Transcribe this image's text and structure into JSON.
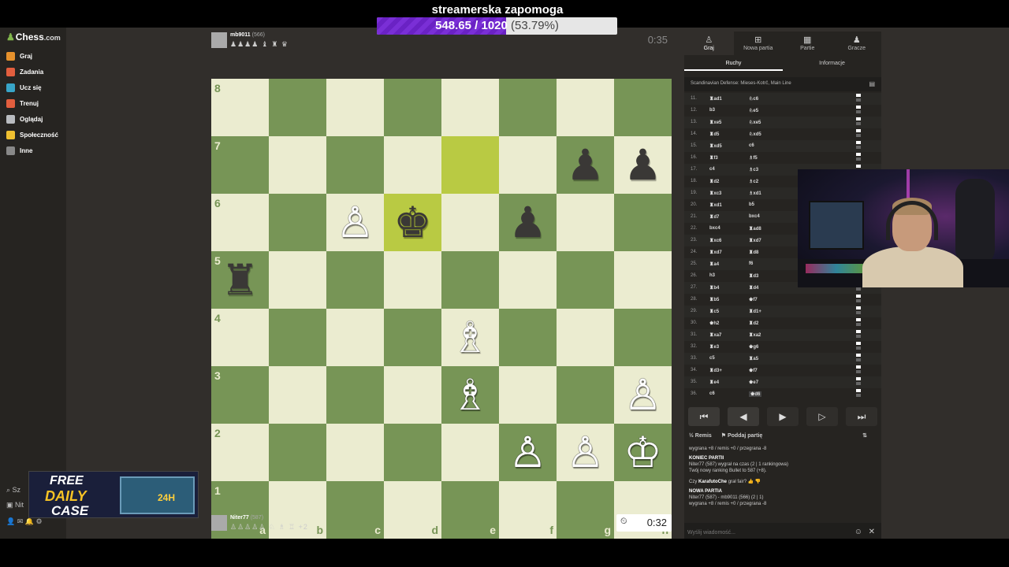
{
  "donation": {
    "title": "streamerska zapomoga",
    "amount_text": "548.65 / 1020",
    "percent_text": "(53.79%)",
    "progress_fraction": 0.5379
  },
  "sidebar": {
    "logo": "Chess",
    "logo_suffix": ".com",
    "items": [
      {
        "label": "Graj",
        "icon": "play-icon",
        "color": "#e6912c"
      },
      {
        "label": "Zadania",
        "icon": "puzzle-icon",
        "color": "#e25e3e"
      },
      {
        "label": "Ucz się",
        "icon": "learn-icon",
        "color": "#38a5c8"
      },
      {
        "label": "Trenuj",
        "icon": "train-icon",
        "color": "#e25e3e"
      },
      {
        "label": "Oglądaj",
        "icon": "watch-icon",
        "color": "#b9bcc0"
      },
      {
        "label": "Społeczność",
        "icon": "community-icon",
        "color": "#f0c030"
      },
      {
        "label": "Inne",
        "icon": "more-icon",
        "color": "#888888"
      }
    ],
    "search_hint": "Sz",
    "user_hint": "Nit"
  },
  "ad": {
    "line1": "FREE",
    "line2": "DAILY",
    "line3": "CASE",
    "badge": "24H"
  },
  "top_player": {
    "name": "mb9011",
    "rating": "(566)",
    "captured": "♟♟♟♟ ♝ ♜ ♛",
    "clock": "0:35"
  },
  "bottom_player": {
    "name": "Niter77",
    "rating": "(587)",
    "captured": "♙♙♙♙♙ ♘ ♗ ♖",
    "clock": "0:32",
    "material": "+2"
  },
  "board": {
    "files": [
      "a",
      "b",
      "c",
      "d",
      "e",
      "f",
      "g",
      "h"
    ],
    "ranks": [
      "8",
      "7",
      "6",
      "5",
      "4",
      "3",
      "2",
      "1"
    ],
    "highlight": [
      "e7",
      "d6"
    ],
    "pieces": {
      "g7": "♟",
      "h7": "♟",
      "d6": "♚",
      "f6": "♟",
      "a5": "♜",
      "c6": "♙",
      "e4": "♗",
      "e3": "♗",
      "h3": "♙",
      "f2": "♙",
      "g2": "♙",
      "h2": "♔"
    },
    "white_pieces": [
      "c6",
      "e4",
      "e3",
      "h3",
      "f2",
      "g2",
      "h2"
    ]
  },
  "panel": {
    "tabs": [
      {
        "label": "Graj",
        "icon": "pawn-icon"
      },
      {
        "label": "Nowa partia",
        "icon": "plus-icon"
      },
      {
        "label": "Partie",
        "icon": "board-icon"
      },
      {
        "label": "Gracze",
        "icon": "players-icon"
      }
    ],
    "subtabs": [
      "Ruchy",
      "Informacje"
    ],
    "opening": "Scandinavian Defense: Mieses-Kotrč, Main Line",
    "moves": [
      {
        "n": "11.",
        "w": "♜ad1",
        "b": "♘c6"
      },
      {
        "n": "12.",
        "w": "b3",
        "b": "♘e5"
      },
      {
        "n": "13.",
        "w": "♜xe5",
        "b": "♘xe5"
      },
      {
        "n": "14.",
        "w": "♜d5",
        "b": "♘xd5"
      },
      {
        "n": "15.",
        "w": "♜xd5",
        "b": "c6"
      },
      {
        "n": "16.",
        "w": "♜f3",
        "b": "♗f5"
      },
      {
        "n": "17.",
        "w": "c4",
        "b": "♗c3"
      },
      {
        "n": "18.",
        "w": "♜d2",
        "b": "♗c2"
      },
      {
        "n": "19.",
        "w": "♜xc3",
        "b": "♗xd1"
      },
      {
        "n": "20.",
        "w": "♜xd1",
        "b": "b5"
      },
      {
        "n": "21.",
        "w": "♜d7",
        "b": "bxc4"
      },
      {
        "n": "22.",
        "w": "bxc4",
        "b": "♜ad8"
      },
      {
        "n": "23.",
        "w": "♜xc6",
        "b": "♜xd7"
      },
      {
        "n": "24.",
        "w": "♜xd7",
        "b": "♜d8"
      },
      {
        "n": "25.",
        "w": "♜a4",
        "b": "f6"
      },
      {
        "n": "26.",
        "w": "h3",
        "b": "♜d3"
      },
      {
        "n": "27.",
        "w": "♜b4",
        "b": "♜d4"
      },
      {
        "n": "28.",
        "w": "♜b5",
        "b": "♚f7"
      },
      {
        "n": "29.",
        "w": "♜c5",
        "b": "♜d1+"
      },
      {
        "n": "30.",
        "w": "♚h2",
        "b": "♜d2"
      },
      {
        "n": "31.",
        "w": "♜xa7",
        "b": "♜xa2"
      },
      {
        "n": "32.",
        "w": "♜e3",
        "b": "♚g6"
      },
      {
        "n": "33.",
        "w": "c5",
        "b": "♜a5"
      },
      {
        "n": "34.",
        "w": "♜d3+",
        "b": "♚f7"
      },
      {
        "n": "35.",
        "w": "♜e4",
        "b": "♚e7"
      },
      {
        "n": "36.",
        "w": "c6",
        "b": "♚d6"
      }
    ],
    "controls": [
      "⏮",
      "◀",
      "▶",
      "▷",
      "⏭"
    ],
    "actions": {
      "draw": "½ Remis",
      "resign": "⚑ Poddaj partię",
      "flip": "⇅"
    },
    "chat": {
      "line1": "wygrana +8 / remis +0 / przegrana -8",
      "game_over_header": "KONIEC PARTII",
      "game_over_1": "Niter77 (587) wygrał na czas (2 | 1 rankingowa)",
      "game_over_2": "Twój nowy ranking Bullet to 587 (+8).",
      "fair_q_prefix": "Czy",
      "fair_q_name": "KarafutoChe",
      "fair_q_suffix": "grał fair?",
      "new_game_header": "NOWA PARTIA",
      "new_game_1": "Niter77 (587) - mb9011 (566) (2 | 1)",
      "new_game_2": "wygrana +8 / remis +0 / przegrana -8"
    },
    "chat_placeholder": "Wyślij wiadomość..."
  }
}
